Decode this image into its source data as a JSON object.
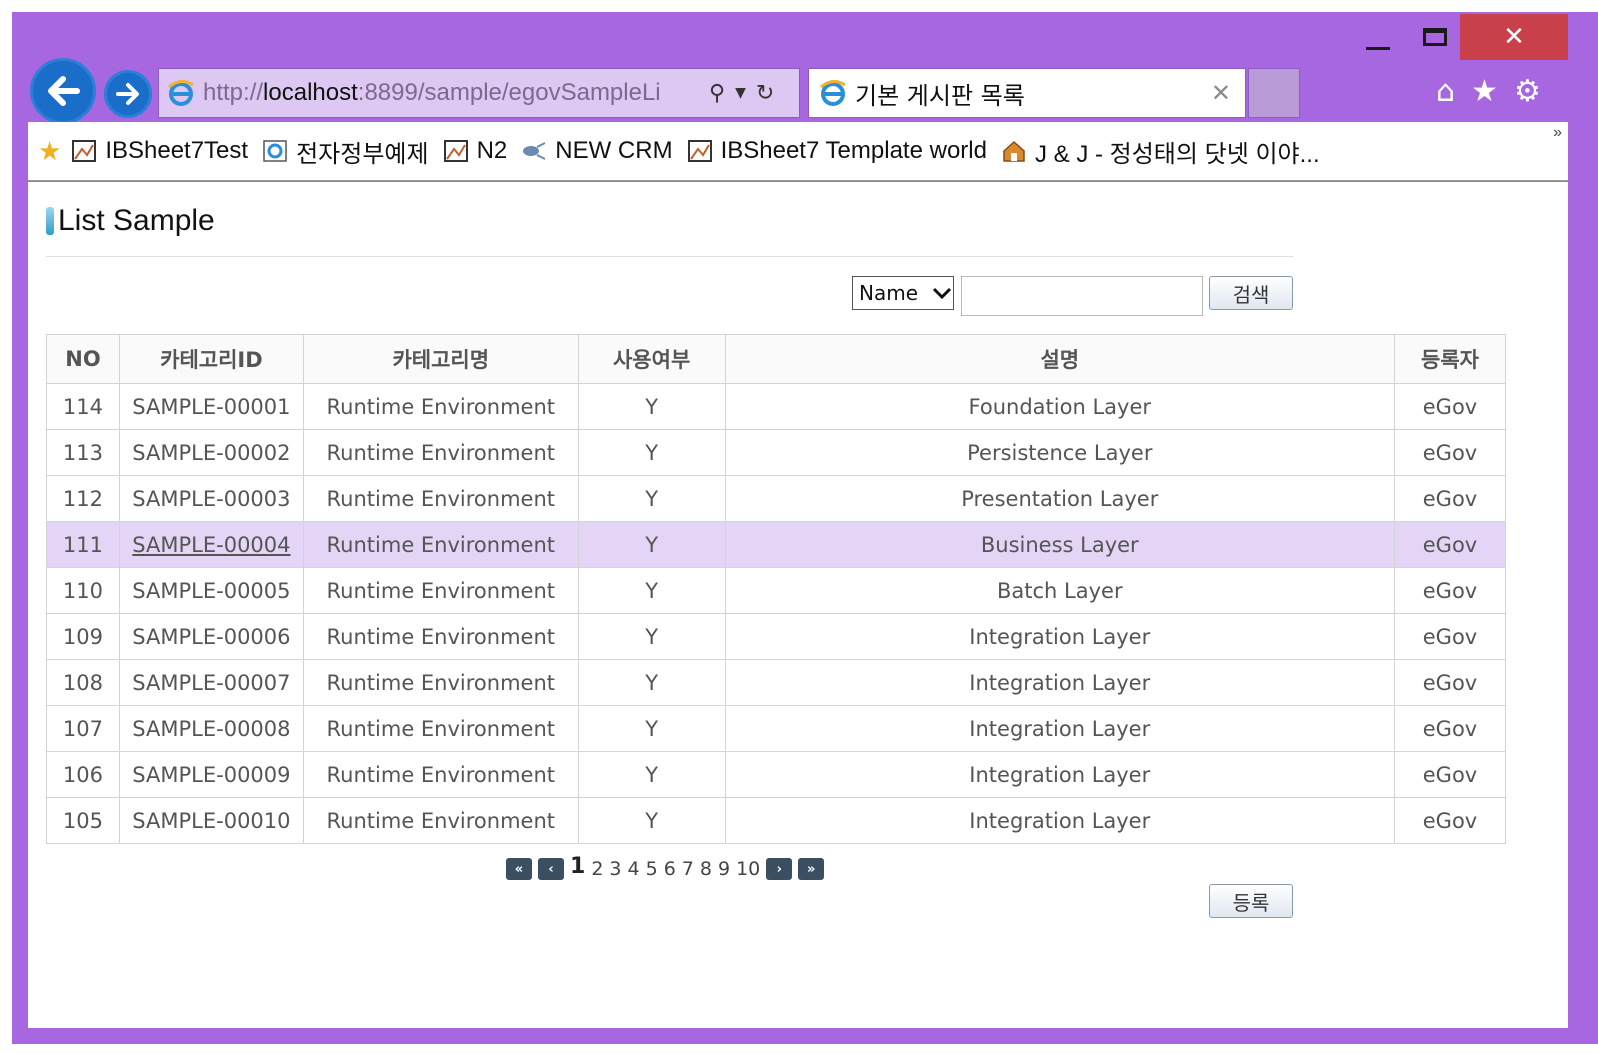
{
  "browser": {
    "url_prefix": "http://",
    "url_host": "localhost",
    "url_rest": ":8899/sample/egovSampleLi",
    "tab_title": "기본 게시판 목록",
    "favorites": [
      {
        "label": "IBSheet7Test"
      },
      {
        "label": "전자정부예제"
      },
      {
        "label": "N2"
      },
      {
        "label": "NEW CRM"
      },
      {
        "label": "IBSheet7 Template world"
      },
      {
        "label": "J & J - 정성태의 닷넷 이야..."
      }
    ]
  },
  "page": {
    "title": "List Sample",
    "search": {
      "select_value": "Name",
      "input_value": "",
      "button_label": "검색"
    },
    "table": {
      "headers": [
        "NO",
        "카테고리ID",
        "카테고리명",
        "사용여부",
        "설명",
        "등록자"
      ],
      "rows": [
        {
          "no": "114",
          "id": "SAMPLE-00001",
          "name": "Runtime Environment",
          "use": "Y",
          "desc": "Foundation Layer",
          "reg": "eGov"
        },
        {
          "no": "113",
          "id": "SAMPLE-00002",
          "name": "Runtime Environment",
          "use": "Y",
          "desc": "Persistence Layer",
          "reg": "eGov"
        },
        {
          "no": "112",
          "id": "SAMPLE-00003",
          "name": "Runtime Environment",
          "use": "Y",
          "desc": "Presentation Layer",
          "reg": "eGov"
        },
        {
          "no": "111",
          "id": "SAMPLE-00004",
          "name": "Runtime Environment",
          "use": "Y",
          "desc": "Business Layer",
          "reg": "eGov"
        },
        {
          "no": "110",
          "id": "SAMPLE-00005",
          "name": "Runtime Environment",
          "use": "Y",
          "desc": "Batch Layer",
          "reg": "eGov"
        },
        {
          "no": "109",
          "id": "SAMPLE-00006",
          "name": "Runtime Environment",
          "use": "Y",
          "desc": "Integration Layer",
          "reg": "eGov"
        },
        {
          "no": "108",
          "id": "SAMPLE-00007",
          "name": "Runtime Environment",
          "use": "Y",
          "desc": "Integration Layer",
          "reg": "eGov"
        },
        {
          "no": "107",
          "id": "SAMPLE-00008",
          "name": "Runtime Environment",
          "use": "Y",
          "desc": "Integration Layer",
          "reg": "eGov"
        },
        {
          "no": "106",
          "id": "SAMPLE-00009",
          "name": "Runtime Environment",
          "use": "Y",
          "desc": "Integration Layer",
          "reg": "eGov"
        },
        {
          "no": "105",
          "id": "SAMPLE-00010",
          "name": "Runtime Environment",
          "use": "Y",
          "desc": "Integration Layer",
          "reg": "eGov"
        }
      ]
    },
    "pagination": {
      "pages": [
        "1",
        "2",
        "3",
        "4",
        "5",
        "6",
        "7",
        "8",
        "9",
        "10"
      ],
      "current": "1"
    },
    "register_label": "등록"
  }
}
